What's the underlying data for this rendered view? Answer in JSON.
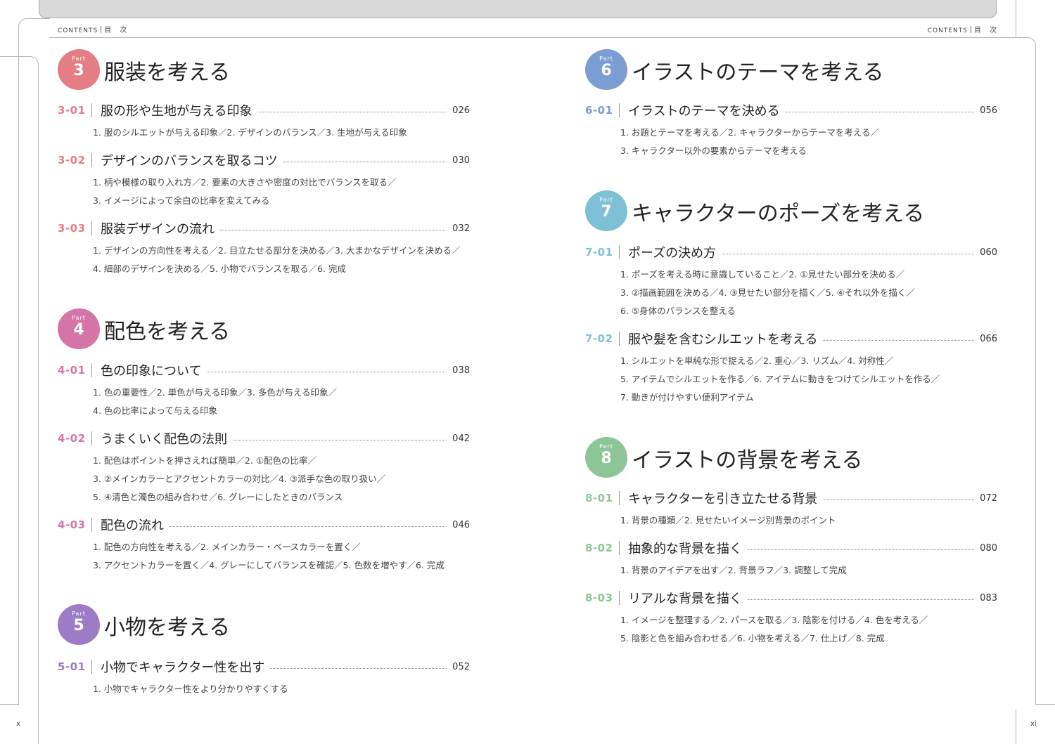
{
  "header": {
    "contents_label": "Contents",
    "contents_jp": "目　次"
  },
  "folios": {
    "left": "x",
    "right": "xi"
  },
  "colors": {
    "part3": "#e57d84",
    "part4": "#d574a7",
    "part5": "#9c7cc6",
    "part6": "#7b9dd4",
    "part7": "#7ec0d6",
    "part8": "#8dc696"
  },
  "parts": [
    {
      "word": "Part",
      "number": "3",
      "title": "服装を考える",
      "entries": [
        {
          "num": "3-01",
          "title": "服の形や生地が与える印象",
          "page": "026",
          "subs": [
            "1. 服のシルエットが与える印象／2. デザインのバランス／3. 生地が与える印象"
          ]
        },
        {
          "num": "3-02",
          "title": "デザインのバランスを取るコツ",
          "page": "030",
          "subs": [
            "1. 柄や模様の取り入れ方／2. 要素の大きさや密度の対比でバランスを取る／",
            "3. イメージによって余白の比率を変えてみる"
          ]
        },
        {
          "num": "3-03",
          "title": "服装デザインの流れ",
          "page": "032",
          "subs": [
            "1. デザインの方向性を考える／2. 目立たせる部分を決める／3. 大まかなデザインを決める／",
            "4. 細部のデザインを決める／5. 小物でバランスを取る／6. 完成"
          ]
        }
      ]
    },
    {
      "word": "Part",
      "number": "4",
      "title": "配色を考える",
      "entries": [
        {
          "num": "4-01",
          "title": "色の印象について",
          "page": "038",
          "subs": [
            "1. 色の重要性／2. 単色が与える印象／3. 多色が与える印象／",
            "4. 色の比率によって与える印象"
          ]
        },
        {
          "num": "4-02",
          "title": "うまくいく配色の法則",
          "page": "042",
          "subs": [
            "1. 配色はポイントを押さえれば簡単／2. ①配色の比率／",
            "3. ②メインカラーとアクセントカラーの対比／4. ③派手な色の取り扱い／",
            "5. ④清色と濁色の組み合わせ／6. グレーにしたときのバランス"
          ]
        },
        {
          "num": "4-03",
          "title": "配色の流れ",
          "page": "046",
          "subs": [
            "1. 配色の方向性を考える／2. メインカラー・ベースカラーを置く／",
            "3. アクセントカラーを置く／4. グレーにしてバランスを確認／5. 色数を増やす／6. 完成"
          ]
        }
      ]
    },
    {
      "word": "Part",
      "number": "5",
      "title": "小物を考える",
      "entries": [
        {
          "num": "5-01",
          "title": "小物でキャラクター性を出す",
          "page": "052",
          "subs": [
            "1. 小物でキャラクター性をより分かりやすくする"
          ]
        }
      ]
    },
    {
      "word": "Part",
      "number": "6",
      "title": "イラストのテーマを考える",
      "entries": [
        {
          "num": "6-01",
          "title": "イラストのテーマを決める",
          "page": "056",
          "subs": [
            "1. お題とテーマを考える／2. キャラクターからテーマを考える／",
            "3. キャラクター以外の要素からテーマを考える"
          ]
        }
      ]
    },
    {
      "word": "Part",
      "number": "7",
      "title": "キャラクターのポーズを考える",
      "entries": [
        {
          "num": "7-01",
          "title": "ポーズの決め方",
          "page": "060",
          "subs": [
            "1. ポーズを考える時に意識していること／2. ①見せたい部分を決める／",
            "3. ②描画範囲を決める／4. ③見せたい部分を描く／5. ④それ以外を描く／",
            "6. ⑤身体のバランスを整える"
          ]
        },
        {
          "num": "7-02",
          "title": "服や髪を含むシルエットを考える",
          "page": "066",
          "subs": [
            "1. シルエットを単純な形で捉える／2. 重心／3. リズム／4. 対称性／",
            "5. アイテムでシルエットを作る／6. アイテムに動きをつけてシルエットを作る／",
            "7. 動きが付けやすい便利アイテム"
          ]
        }
      ]
    },
    {
      "word": "Part",
      "number": "8",
      "title": "イラストの背景を考える",
      "entries": [
        {
          "num": "8-01",
          "title": "キャラクターを引き立たせる背景",
          "page": "072",
          "subs": [
            "1. 背景の種類／2. 見せたいイメージ別背景のポイント"
          ]
        },
        {
          "num": "8-02",
          "title": "抽象的な背景を描く",
          "page": "080",
          "subs": [
            "1. 背景のアイデアを出す／2. 背景ラフ／3. 調整して完成"
          ]
        },
        {
          "num": "8-03",
          "title": "リアルな背景を描く",
          "page": "083",
          "subs": [
            "1. イメージを整理する／2. パースを取る／3. 陰影を付ける／4. 色を考える／",
            "5. 陰影と色を組み合わせる／6. 小物を考える／7. 仕上げ／8. 完成"
          ]
        }
      ]
    }
  ]
}
